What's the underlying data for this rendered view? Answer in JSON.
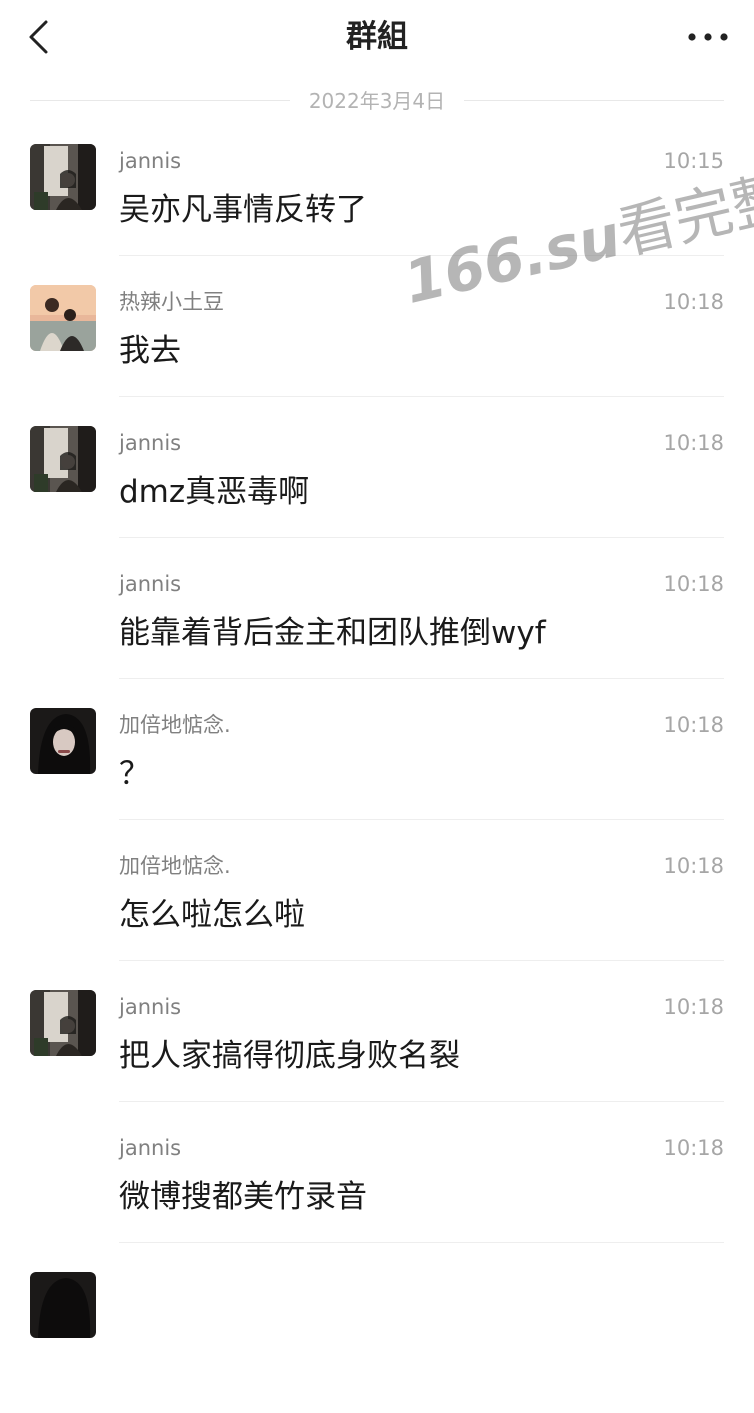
{
  "header": {
    "title": "群組"
  },
  "date_separator": "2022年3月4日",
  "messages": [
    {
      "sender": "jannis",
      "time": "10:15",
      "text": "吴亦凡事情反转了",
      "avatar": "jannis-avatar"
    },
    {
      "sender": "热辣小土豆",
      "time": "10:18",
      "text": "我去",
      "avatar": "potato-avatar"
    },
    {
      "sender": "jannis",
      "time": "10:18",
      "text": "dmz真恶毒啊",
      "avatar": "jannis-avatar"
    },
    {
      "sender": "jannis",
      "time": "10:18",
      "text": "能靠着背后金主和团队推倒wyf",
      "avatar": null
    },
    {
      "sender": "加倍地惦念.",
      "time": "10:18",
      "text": "？",
      "avatar": "girl-avatar"
    },
    {
      "sender": "加倍地惦念.",
      "time": "10:18",
      "text": "怎么啦怎么啦",
      "avatar": null
    },
    {
      "sender": "jannis",
      "time": "10:18",
      "text": "把人家搞得彻底身败名裂",
      "avatar": "jannis-avatar"
    },
    {
      "sender": "jannis",
      "time": "10:18",
      "text": "微博搜都美竹录音",
      "avatar": null
    }
  ],
  "watermark": {
    "domain": "166.su",
    "text": "看完整版"
  },
  "icons": {
    "back": "chevron-left-icon",
    "more": "more-dots-icon"
  },
  "colors": {
    "background": "#ffffff",
    "title": "#222222",
    "sender": "#808080",
    "time": "#a6a6a6",
    "message": "#1a1a1a"
  }
}
